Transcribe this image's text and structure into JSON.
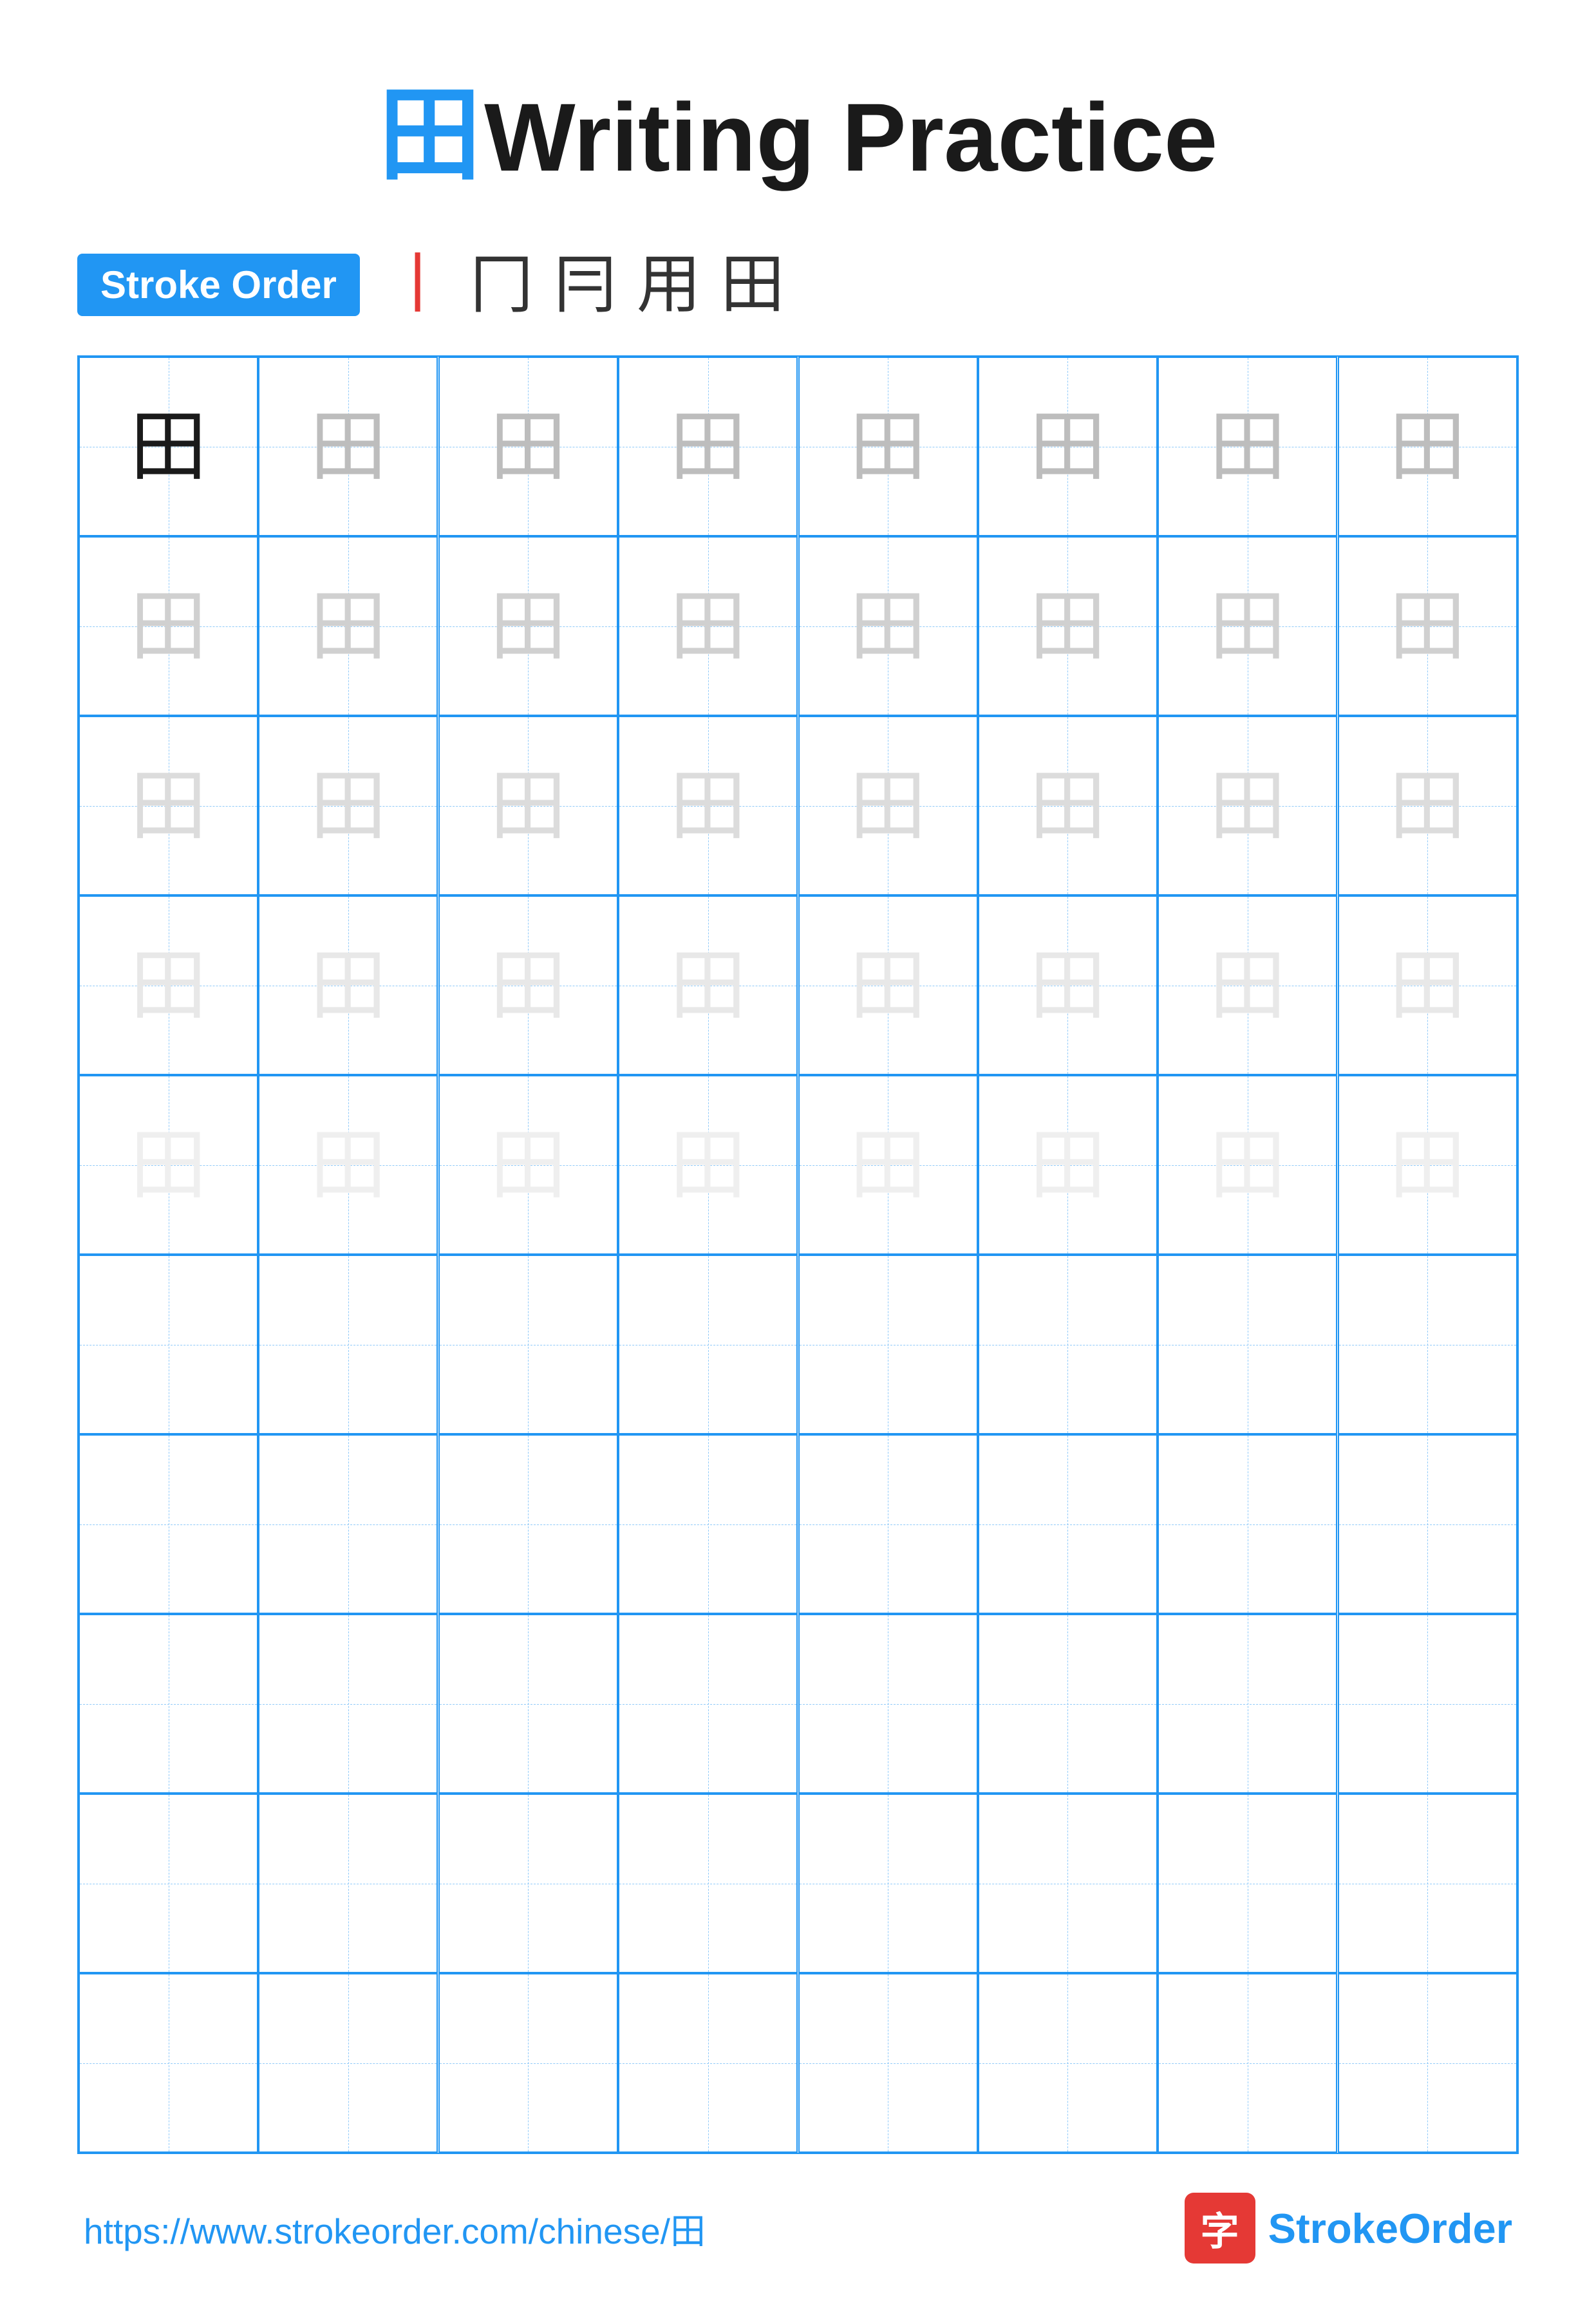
{
  "title": {
    "char": "田",
    "text": "Writing Practice"
  },
  "stroke_order": {
    "badge_label": "Stroke Order",
    "steps": [
      "丨",
      "冂",
      "冃",
      "用",
      "田"
    ]
  },
  "grid": {
    "cols": 8,
    "rows": 10,
    "filled_rows": 5,
    "char": "田",
    "shades": [
      "dark",
      "gray1",
      "gray2",
      "gray3",
      "gray4"
    ]
  },
  "footer": {
    "url": "https://www.strokeorder.com/chinese/田",
    "brand_icon": "字",
    "brand_name_black": "Stroke",
    "brand_name_blue": "Order"
  }
}
